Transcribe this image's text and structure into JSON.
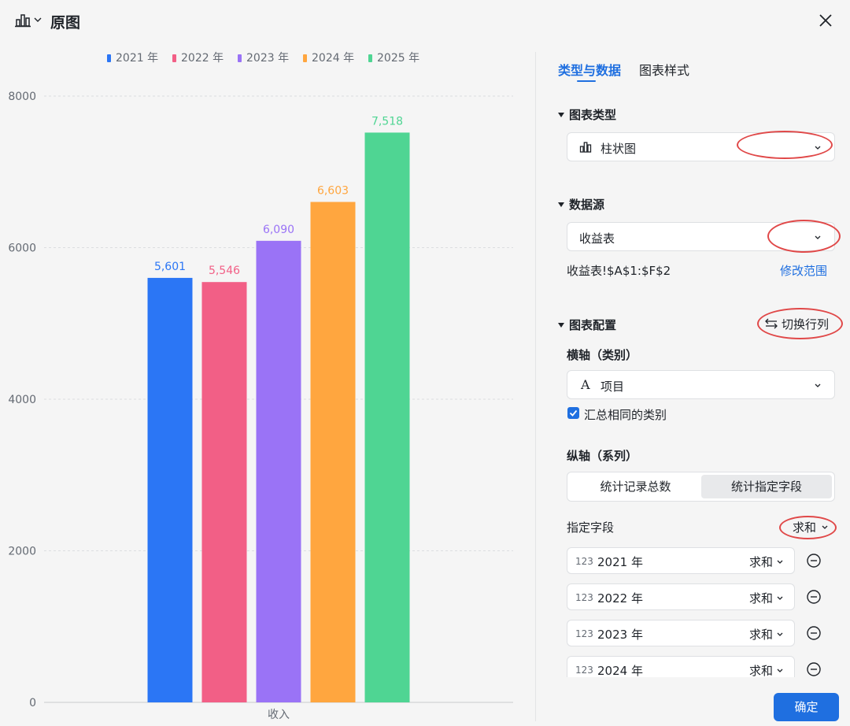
{
  "header": {
    "title": "原图"
  },
  "chart_data": {
    "type": "bar",
    "categories": [
      "收入"
    ],
    "series": [
      {
        "name": "2021 年",
        "values": [
          5601
        ],
        "label": "5,601",
        "color": "#2b76f5"
      },
      {
        "name": "2022 年",
        "values": [
          5546
        ],
        "label": "5,546",
        "color": "#f25f86"
      },
      {
        "name": "2023 年",
        "values": [
          6090
        ],
        "label": "6,090",
        "color": "#9a73f6"
      },
      {
        "name": "2024 年",
        "values": [
          6603
        ],
        "label": "6,603",
        "color": "#ffa63f"
      },
      {
        "name": "2025 年",
        "values": [
          7518
        ],
        "label": "7,518",
        "color": "#4fd593"
      }
    ],
    "yticks": [
      0,
      2000,
      4000,
      6000,
      8000
    ],
    "ylim": [
      0,
      8000
    ],
    "grid": true,
    "legend_position": "top"
  },
  "panel": {
    "tabs": [
      {
        "label": "类型与数据",
        "active": true
      },
      {
        "label": "图表样式",
        "active": false
      }
    ],
    "chart_type": {
      "title": "图表类型",
      "value": "柱状图"
    },
    "data_source": {
      "title": "数据源",
      "value": "收益表",
      "range": "收益表!$A$1:$F$2",
      "modify_label": "修改范围"
    },
    "chart_config": {
      "title": "图表配置",
      "swap_label": "切换行列",
      "x_axis_title": "横轴（类别）",
      "x_axis_value": "项目",
      "aggregate_label": "汇总相同的类别",
      "aggregate_checked": true,
      "y_axis_title": "纵轴（系列）",
      "y_modes": [
        "统计记录总数",
        "统计指定字段"
      ],
      "y_mode_active": 1,
      "field_label": "指定字段",
      "field_agg": "求和",
      "fields": [
        {
          "num": "123",
          "name": "2021 年",
          "agg": "求和"
        },
        {
          "num": "123",
          "name": "2022 年",
          "agg": "求和"
        },
        {
          "num": "123",
          "name": "2023 年",
          "agg": "求和"
        },
        {
          "num": "123",
          "name": "2024 年",
          "agg": "求和"
        }
      ]
    },
    "confirm_label": "确定"
  }
}
